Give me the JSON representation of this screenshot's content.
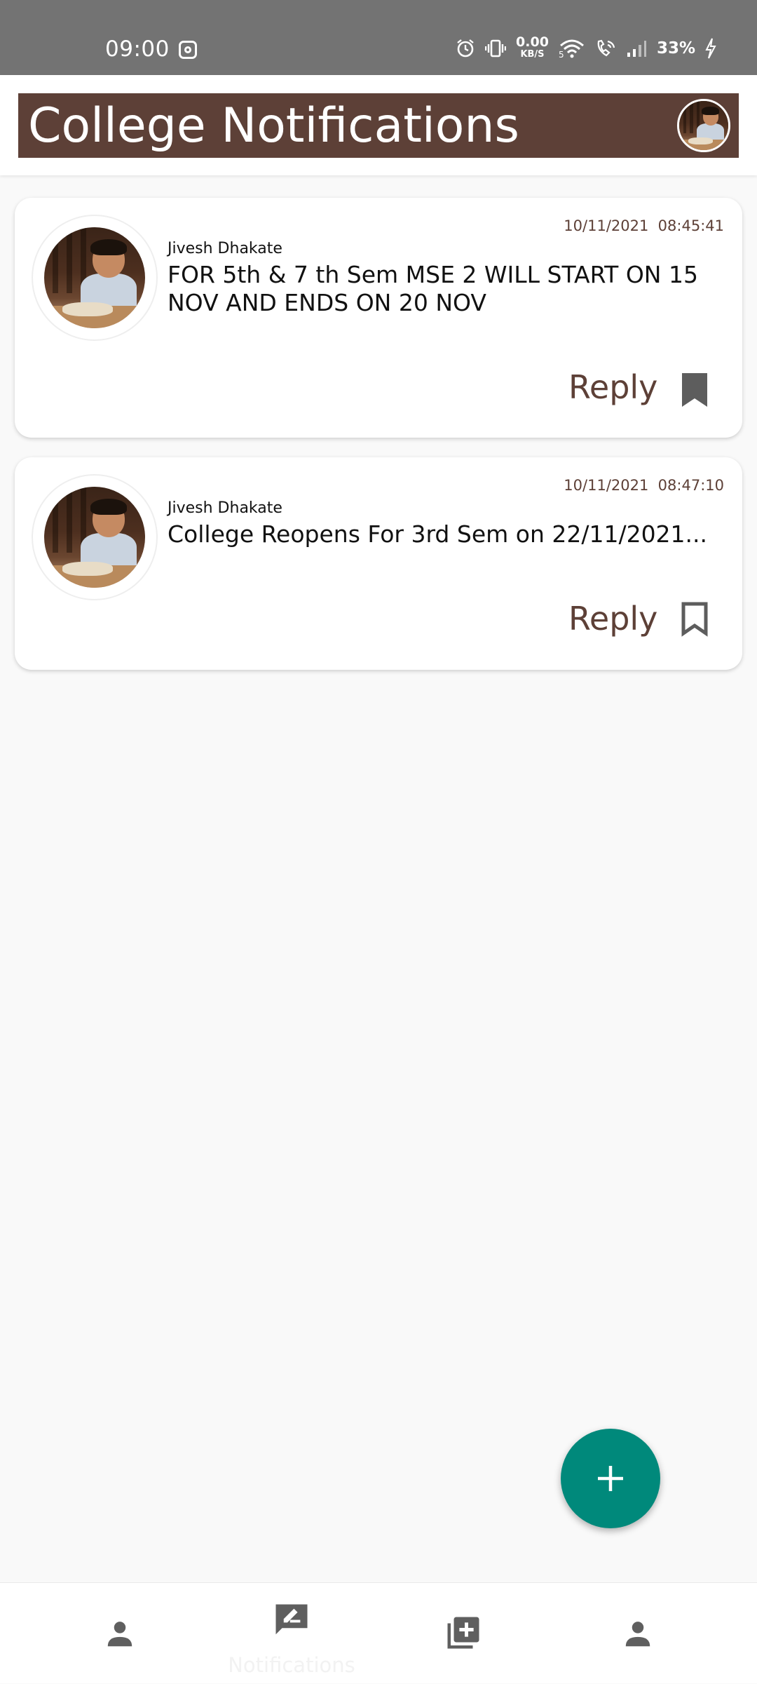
{
  "status_bar": {
    "time": "09:00",
    "net_speed_value": "0.00",
    "net_speed_unit": "KB/S",
    "battery": "33%"
  },
  "header": {
    "title": "College Notifications"
  },
  "notifications": [
    {
      "author": "Jivesh Dhakate",
      "timestamp": "10/11/2021  08:45:41",
      "message": "FOR 5th & 7 th Sem MSE 2 WILL START ON 15 NOV AND ENDS ON 20 NOV",
      "reply_label": "Reply",
      "bookmarked": true
    },
    {
      "author": "Jivesh Dhakate",
      "timestamp": "10/11/2021  08:47:10",
      "message": "College Reopens For 3rd Sem on 22/11/2021...",
      "reply_label": "Reply",
      "bookmarked": false
    }
  ],
  "fab": {
    "icon": "plus-icon"
  },
  "bottom_nav": {
    "items": [
      {
        "icon": "person-icon",
        "label": ""
      },
      {
        "icon": "rate-review-icon",
        "label": "Notifications",
        "active": true
      },
      {
        "icon": "library-add-icon",
        "label": ""
      },
      {
        "icon": "person-icon",
        "label": ""
      }
    ]
  },
  "colors": {
    "brand": "#5d4037",
    "fab": "#00897b",
    "status_bar": "#737373"
  }
}
